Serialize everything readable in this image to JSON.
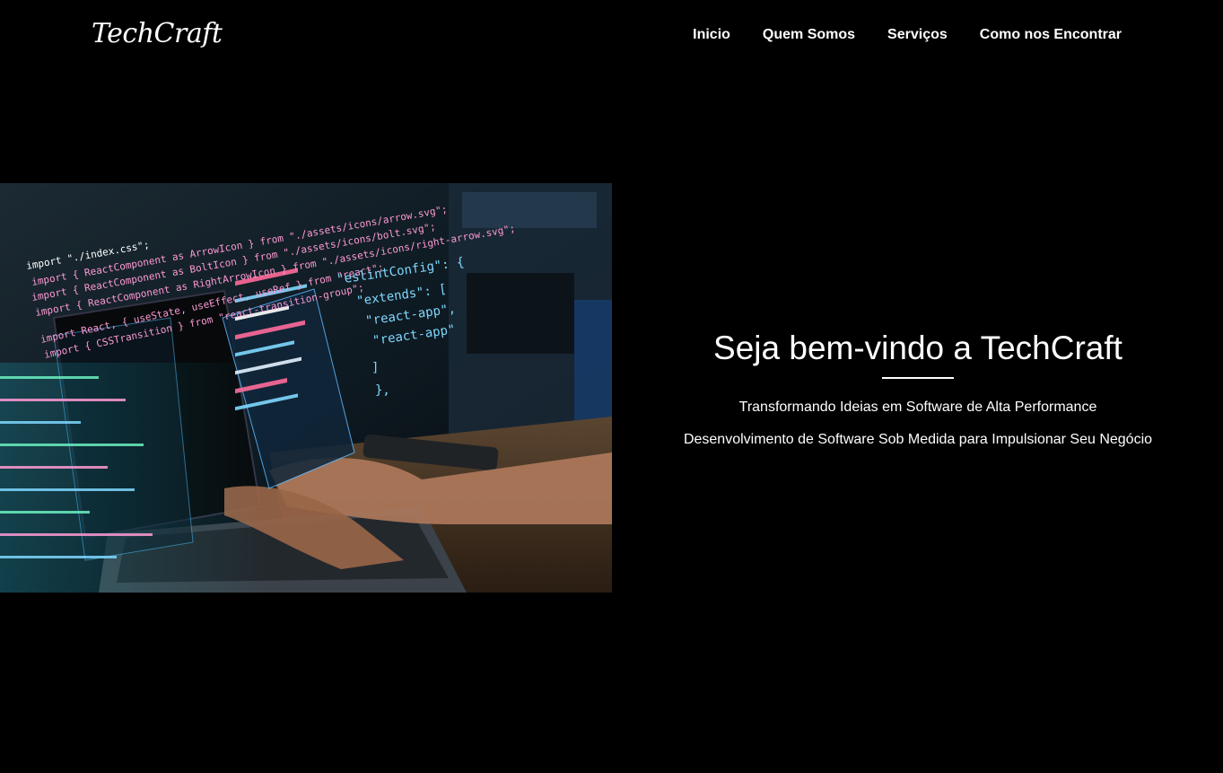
{
  "header": {
    "logo": "TechCraft",
    "nav": [
      {
        "label": "Inicio"
      },
      {
        "label": "Quem Somos"
      },
      {
        "label": "Serviços"
      },
      {
        "label": "Como nos Encontrar"
      }
    ]
  },
  "hero": {
    "title": "Seja bem-vindo a TechCraft",
    "subtitle": "Transformando Ideias em Software de Alta Performance",
    "tagline": "Desenvolvimento de Software Sob Medida para Impulsionar Seu Negócio",
    "image": {
      "icon": "developer-coding-photo",
      "code_lines": [
        "import \"./index.css\";",
        "import { ReactComponent as ArrowIcon } from \"./assets/icons/arrow.svg\";",
        "import { ReactComponent as BoltIcon } from \"./assets/icons/bolt.svg\";",
        "import { ReactComponent as RightArrowIcon } from \"./assets/icons/right-arrow.svg\";",
        "import React, { useState, useEffect, useRef } from \"react\";",
        "import { CSSTransition } from \"react-transition-group\";"
      ],
      "eslint_lines": [
        "\"eslintConfig\": {",
        "\"extends\": [",
        "\"react-app\",",
        "\"react-app\"",
        "]",
        "},"
      ]
    }
  },
  "colors": {
    "background": "#000000",
    "text": "#ffffff",
    "code_pink": "#ff9ad5",
    "code_cyan": "#7fd8ff"
  }
}
